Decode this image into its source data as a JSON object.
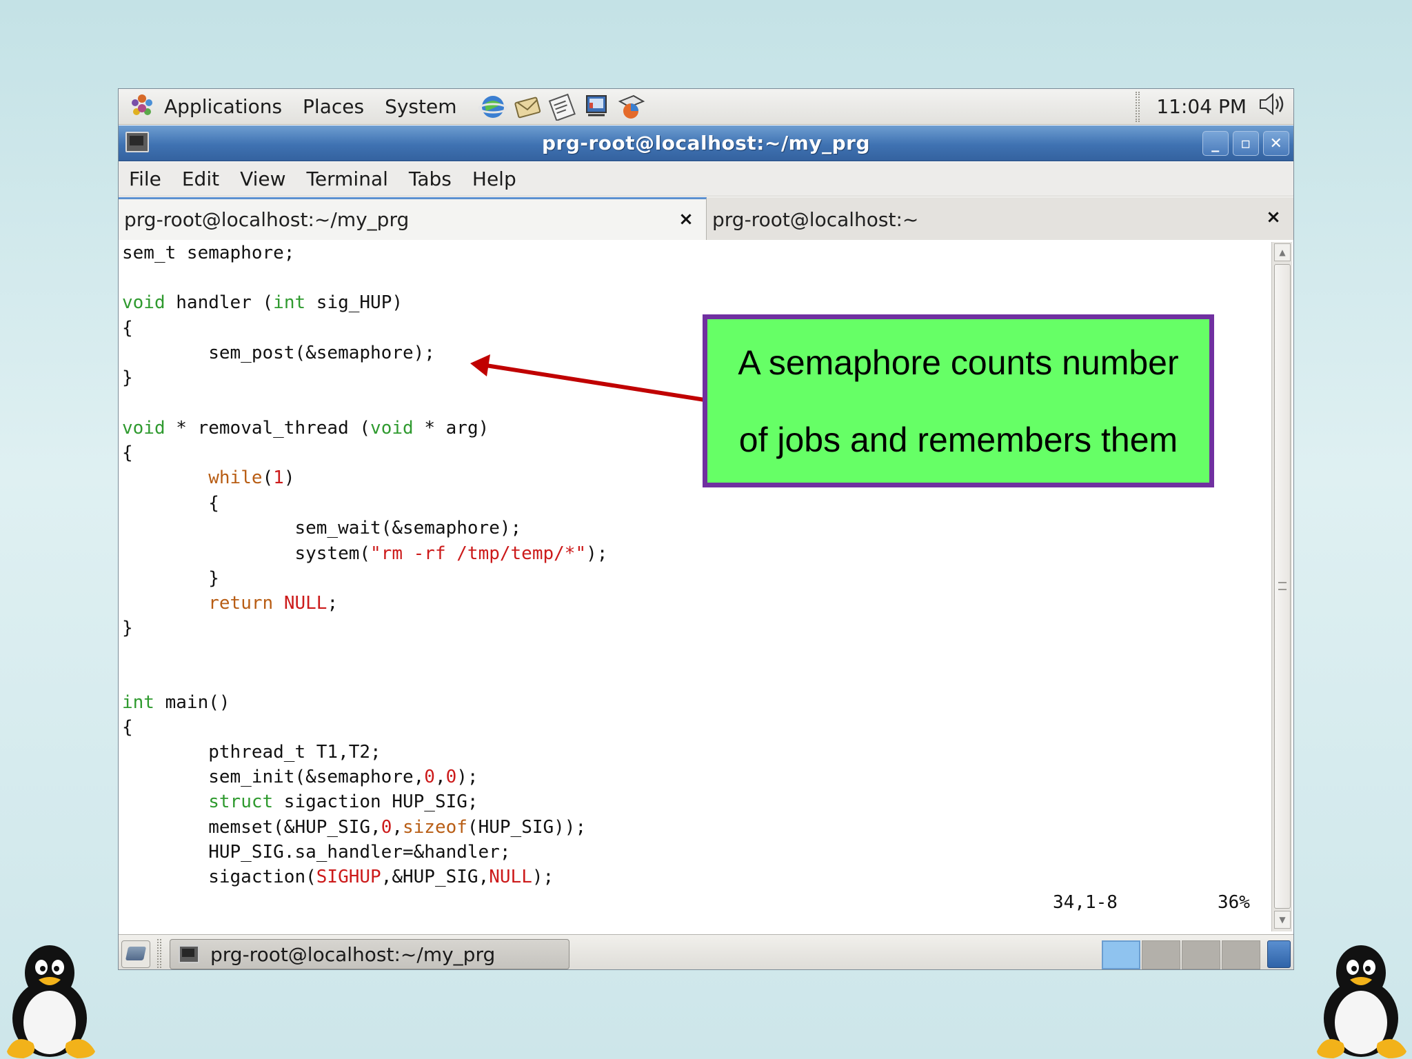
{
  "panel": {
    "menus": [
      "Applications",
      "Places",
      "System"
    ],
    "clock": "11:04 PM"
  },
  "window": {
    "title": "prg-root@localhost:~/my_prg"
  },
  "menubar": [
    "File",
    "Edit",
    "View",
    "Terminal",
    "Tabs",
    "Help"
  ],
  "tabs": [
    {
      "label": "prg-root@localhost:~/my_prg",
      "close": "×"
    },
    {
      "label": "prg-root@localhost:~",
      "close": "×"
    }
  ],
  "code": {
    "lines": {
      "l1": "sem_t semaphore;",
      "l3_kw": "void",
      "l3_a": " handler (",
      "l3_kw2": "int",
      "l3_b": " sig_HUP)",
      "l4": "{",
      "l5": "        sem_post(&semaphore);",
      "l6": "}",
      "l8_kw": "void",
      "l8_a": " * removal_thread (",
      "l8_kw2": "void",
      "l8_b": " * arg)",
      "l9": "{",
      "l10_pre": "        ",
      "l10_ctl": "while",
      "l10_a": "(",
      "l10_lit": "1",
      "l10_b": ")",
      "l11": "        {",
      "l12": "                sem_wait(&semaphore);",
      "l13_a": "                system(",
      "l13_lit": "\"rm -rf /tmp/temp/*\"",
      "l13_b": ");",
      "l14": "        }",
      "l15_pre": "        ",
      "l15_ctl": "return",
      "l15_sp": " ",
      "l15_lit": "NULL",
      "l15_b": ";",
      "l16": "}",
      "l19_kw": "int",
      "l19_a": " main()",
      "l20": "{",
      "l21": "        pthread_t T1,T2;",
      "l22_a": "        sem_init(&semaphore,",
      "l22_lit1": "0",
      "l22_c": ",",
      "l22_lit2": "0",
      "l22_b": ");",
      "l23_pre": "        ",
      "l23_kw": "struct",
      "l23_a": " sigaction HUP_SIG;",
      "l24_a": "        memset(&HUP_SIG,",
      "l24_lit": "0",
      "l24_c": ",",
      "l24_ctl": "sizeof",
      "l24_b": "(HUP_SIG));",
      "l25": "        HUP_SIG.sa_handler=&handler;",
      "l26_a": "        sigaction(",
      "l26_lit1": "SIGHUP",
      "l26_c": ",&HUP_SIG,",
      "l26_lit2": "NULL",
      "l26_b": ");"
    },
    "position": "34,1-8",
    "percent": "36%"
  },
  "taskbar": {
    "task_label": "prg-root@localhost:~/my_prg"
  },
  "annotation": {
    "line1": "A semaphore counts number",
    "line2": "of jobs and remembers them"
  },
  "colors": {
    "keyword": "#2f9a2f",
    "control": "#b85d14",
    "literal": "#cc1a1a",
    "callout_fill": "#66ff66",
    "callout_border": "#7030a0",
    "arrow": "#c00000"
  }
}
